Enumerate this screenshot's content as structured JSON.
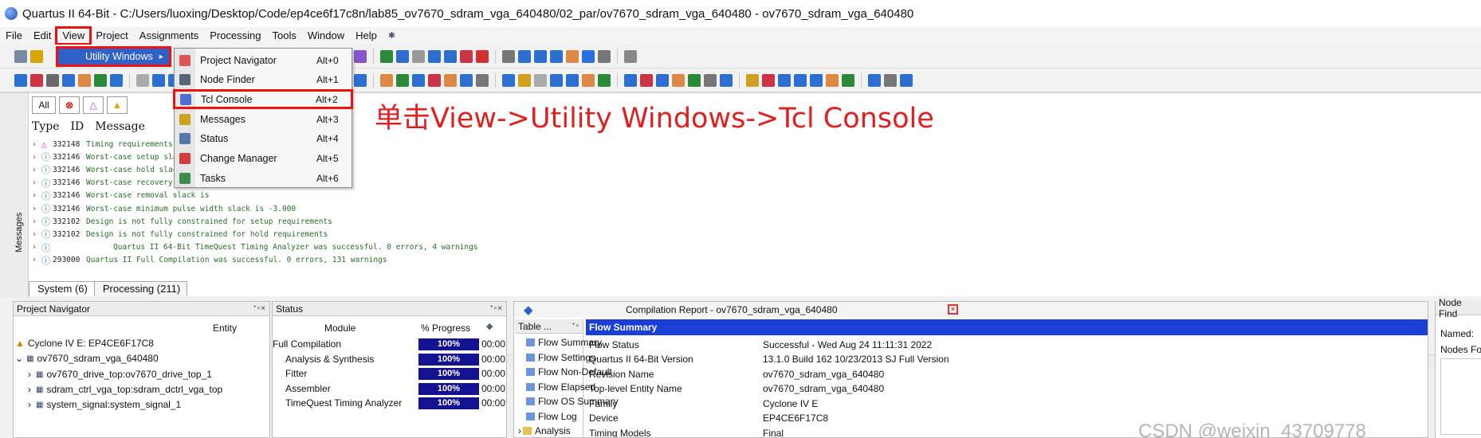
{
  "window": {
    "title": "Quartus II 64-Bit - C:/Users/luoxing/Desktop/Code/ep4ce6f17c8n/lab85_ov7670_sdram_vga_640480/02_par/ov7670_sdram_vga_640480 - ov7670_sdram_vga_640480"
  },
  "menubar": {
    "items": [
      "File",
      "Edit",
      "View",
      "Project",
      "Assignments",
      "Processing",
      "Tools",
      "Window",
      "Help"
    ],
    "help_icon": "pin-icon"
  },
  "view_menu": {
    "utility_windows_label": "Utility Windows",
    "submenu_arrow": "▸",
    "submenu": [
      {
        "label": "Project Navigator",
        "shortcut": "Alt+0"
      },
      {
        "label": "Node Finder",
        "shortcut": "Alt+1"
      },
      {
        "label": "Tcl Console",
        "shortcut": "Alt+2"
      },
      {
        "label": "Messages",
        "shortcut": "Alt+3"
      },
      {
        "label": "Status",
        "shortcut": "Alt+4"
      },
      {
        "label": "Change Manager",
        "shortcut": "Alt+5"
      },
      {
        "label": "Tasks",
        "shortcut": "Alt+6"
      }
    ]
  },
  "annotation": {
    "text": "单击View->Utility Windows->Tcl Console",
    "color": "#e02020"
  },
  "messages": {
    "filter_all": "All",
    "col_type": "Type",
    "col_id": "ID",
    "col_message": "Message",
    "side_label": "Messages",
    "rows": [
      {
        "id": "332148",
        "text": "Timing requirements not met"
      },
      {
        "id": "332146",
        "text": "Worst-case setup slack is"
      },
      {
        "id": "332146",
        "text": "Worst-case hold slack is"
      },
      {
        "id": "332146",
        "text": "Worst-case recovery slack is"
      },
      {
        "id": "332146",
        "text": "Worst-case removal slack is"
      },
      {
        "id": "332146",
        "text": "Worst-case minimum pulse width slack is -3.000"
      },
      {
        "id": "332102",
        "text": "Design is not fully constrained for setup requirements"
      },
      {
        "id": "332102",
        "text": "Design is not fully constrained for hold requirements"
      },
      {
        "id": "",
        "text": "Quartus II 64-Bit TimeQuest Timing Analyzer was successful. 0 errors, 4 warnings"
      },
      {
        "id": "293000",
        "text": "Quartus II Full Compilation was successful. 0 errors, 131 warnings"
      }
    ],
    "tabs": [
      "System (6)",
      "Processing (211)"
    ]
  },
  "project_navigator": {
    "title": "Project Navigator",
    "column": "Entity",
    "device": "Cyclone IV E: EP4CE6F17C8",
    "top": "ov7670_sdram_vga_640480",
    "children": [
      "ov7670_drive_top:ov7670_drive_top_1",
      "sdram_ctrl_vga_top:sdram_dctrl_vga_top",
      "system_signal:system_signal_1"
    ]
  },
  "status_panel": {
    "title": "Status",
    "col_module": "Module",
    "col_progress": "% Progress",
    "rows": [
      {
        "module": "Full Compilation",
        "progress": "100%",
        "time": "00:00"
      },
      {
        "module": "Analysis & Synthesis",
        "progress": "100%",
        "time": "00:00"
      },
      {
        "module": "Fitter",
        "progress": "100%",
        "time": "00:00"
      },
      {
        "module": "Assembler",
        "progress": "100%",
        "time": "00:00"
      },
      {
        "module": "TimeQuest Timing Analyzer",
        "progress": "100%",
        "time": "00:00"
      }
    ]
  },
  "compilation_report": {
    "title": "Compilation Report - ov7670_sdram_vga_640480",
    "toc_header": "Table ...",
    "toc": [
      "Flow Summary",
      "Flow Settings",
      "Flow Non-Default",
      "Flow Elapsed",
      "Flow OS Summary",
      "Flow Log",
      "Analysis"
    ],
    "section": "Flow Summary",
    "rows": [
      {
        "key": "Flow Status",
        "value": "Successful - Wed Aug 24 11:11:31 2022"
      },
      {
        "key": "Quartus II 64-Bit Version",
        "value": "13.1.0 Build 162 10/23/2013 SJ Full Version"
      },
      {
        "key": "Revision Name",
        "value": "ov7670_sdram_vga_640480"
      },
      {
        "key": "Top-level Entity Name",
        "value": "ov7670_sdram_vga_640480"
      },
      {
        "key": "Family",
        "value": "Cyclone IV E"
      },
      {
        "key": "Device",
        "value": "EP4CE6F17C8"
      },
      {
        "key": "Timing Models",
        "value": "Final"
      }
    ]
  },
  "node_finder": {
    "title": "Node Find",
    "named_label": "Named:",
    "nodes_label": "Nodes Fo"
  },
  "watermark": "CSDN @weixin_43709778"
}
